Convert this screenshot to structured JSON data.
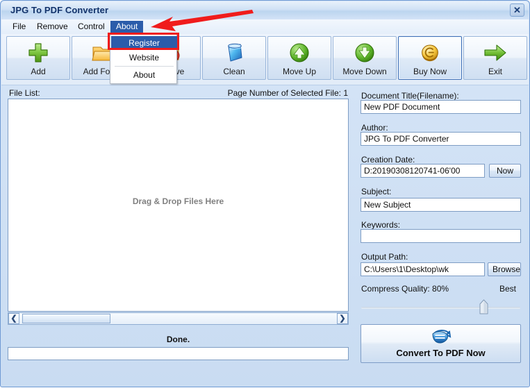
{
  "window": {
    "title": "JPG To PDF Converter",
    "close_label": "✕"
  },
  "menubar": {
    "items": [
      {
        "label": "File",
        "active": false
      },
      {
        "label": "Remove",
        "active": false
      },
      {
        "label": "Control",
        "active": false
      },
      {
        "label": "About",
        "active": true
      }
    ]
  },
  "dropdown": {
    "items": [
      {
        "label": "Register",
        "highlighted": true
      },
      {
        "label": "Website",
        "highlighted": false
      },
      {
        "label": "About",
        "highlighted": false
      }
    ],
    "annotation_color": "#f01c1c"
  },
  "toolbar": {
    "buttons": [
      {
        "label": "Add",
        "icon": "green-plus-icon",
        "selected": false
      },
      {
        "label": "Add Folder",
        "icon": "folder-icon",
        "selected": false
      },
      {
        "label": "Remove",
        "icon": "remove-icon",
        "selected": false
      },
      {
        "label": "Clean",
        "icon": "trash-can-icon",
        "selected": false
      },
      {
        "label": "Move Up",
        "icon": "arrow-up-circle-icon",
        "selected": false
      },
      {
        "label": "Move Down",
        "icon": "arrow-down-circle-icon",
        "selected": false
      },
      {
        "label": "Buy Now",
        "icon": "gold-coin-icon",
        "selected": true
      },
      {
        "label": "Exit",
        "icon": "green-right-arrow-icon",
        "selected": false
      }
    ]
  },
  "left_panel": {
    "file_list_label": "File List:",
    "page_number_label": "Page Number of Selected File: 1",
    "drop_hint": "Drag & Drop Files Here",
    "status": "Done.",
    "scroll_left_glyph": "❮",
    "scroll_right_glyph": "❯"
  },
  "right_panel": {
    "document_title_label": "Document Title(Filename):",
    "document_title_value": "New PDF Document",
    "author_label": "Author:",
    "author_value": "JPG To PDF Converter",
    "creation_date_label": "Creation Date:",
    "creation_date_value": "D:20190308120741-06'00",
    "now_button": "Now",
    "subject_label": "Subject:",
    "subject_value": "New Subject",
    "keywords_label": "Keywords:",
    "keywords_value": "",
    "output_path_label": "Output Path:",
    "output_path_value": "C:\\Users\\1\\Desktop\\wk",
    "browse_button": "Browse",
    "compress_quality_label": "Compress Quality: 80%",
    "compress_quality_best": "Best",
    "compress_quality_percent": 80,
    "convert_button": "Convert To PDF Now",
    "convert_icon": "pdf-convert-icon"
  }
}
